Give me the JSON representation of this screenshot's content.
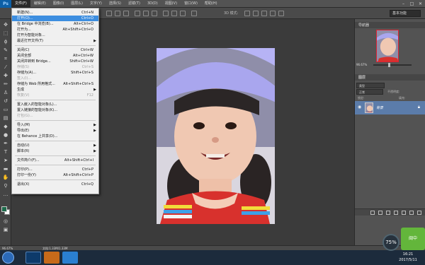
{
  "menubar": {
    "app_logo": "Ps",
    "items": [
      "文件(F)",
      "编辑(E)",
      "图像(I)",
      "图层(L)",
      "文字(Y)",
      "选择(S)",
      "滤镜(T)",
      "3D(D)",
      "视图(V)",
      "窗口(W)",
      "帮助(H)"
    ],
    "window_controls": [
      "–",
      "□",
      "✕"
    ]
  },
  "optbar": {
    "mode_label": "3D 模式:",
    "workspace": "基本功能"
  },
  "file_menu": {
    "items": [
      {
        "label": "新建(N)...",
        "shortcut": "Ctrl+N"
      },
      {
        "label": "打开(O)...",
        "shortcut": "Ctrl+O",
        "highlight": true
      },
      {
        "label": "在 Bridge 中浏览(B)...",
        "shortcut": "Alt+Ctrl+O"
      },
      {
        "label": "打开为...",
        "shortcut": "Alt+Shift+Ctrl+O"
      },
      {
        "label": "打开为智能对象..."
      },
      {
        "label": "最近打开文件(T)",
        "submenu": true
      },
      {
        "label": "关闭(C)",
        "shortcut": "Ctrl+W"
      },
      {
        "label": "关闭全部",
        "shortcut": "Alt+Ctrl+W"
      },
      {
        "label": "关闭并转到 Bridge...",
        "shortcut": "Shift+Ctrl+W"
      },
      {
        "label": "存储(S)",
        "shortcut": "Ctrl+S",
        "disabled": true
      },
      {
        "label": "存储为(A)...",
        "shortcut": "Shift+Ctrl+S"
      },
      {
        "label": "签入(I)...",
        "disabled": true
      },
      {
        "label": "存储为 Web 所用格式...",
        "shortcut": "Alt+Shift+Ctrl+S"
      },
      {
        "label": "生成",
        "submenu": true
      },
      {
        "label": "恢复(V)",
        "shortcut": "F12",
        "disabled": true
      },
      {
        "label": "置入嵌入的智能对象(L)..."
      },
      {
        "label": "置入链接的智能对象(K)..."
      },
      {
        "label": "打包(G)...",
        "disabled": true
      },
      {
        "label": "导入(M)",
        "submenu": true
      },
      {
        "label": "导出(E)",
        "submenu": true
      },
      {
        "label": "在 Behance 上共享(D)..."
      },
      {
        "label": "自动(U)",
        "submenu": true
      },
      {
        "label": "脚本(R)",
        "submenu": true
      },
      {
        "label": "文件简介(F)...",
        "shortcut": "Alt+Shift+Ctrl+I"
      },
      {
        "label": "打印(P)...",
        "shortcut": "Ctrl+P"
      },
      {
        "label": "打印一份(Y)",
        "shortcut": "Alt+Shift+Ctrl+P"
      },
      {
        "label": "退出(X)",
        "shortcut": "Ctrl+Q"
      }
    ]
  },
  "navigator": {
    "title": "导航器",
    "zoom": "96.67%",
    "zoom_fraction": 0.42
  },
  "layers": {
    "tab_label": "图层",
    "kind_filter": "类型",
    "blend_mode": "正常",
    "opacity_label": "不透明度:",
    "fill_label": "填充:",
    "lock_label": "锁定:",
    "layer_name": "背景"
  },
  "status": {
    "zoom": "96.67%",
    "doc_info": "文档:1.33M/1.33M"
  },
  "taskbar": {
    "time": "16:21",
    "date": "2017/5/11"
  },
  "widgets": {
    "net_percent": "75%",
    "green_label": "闽中"
  },
  "colors": {
    "foreground": "#1c6b4a",
    "background": "#ffffff",
    "menu_highlight": "#3d8ee0",
    "layer_selected": "#5b7caa"
  }
}
